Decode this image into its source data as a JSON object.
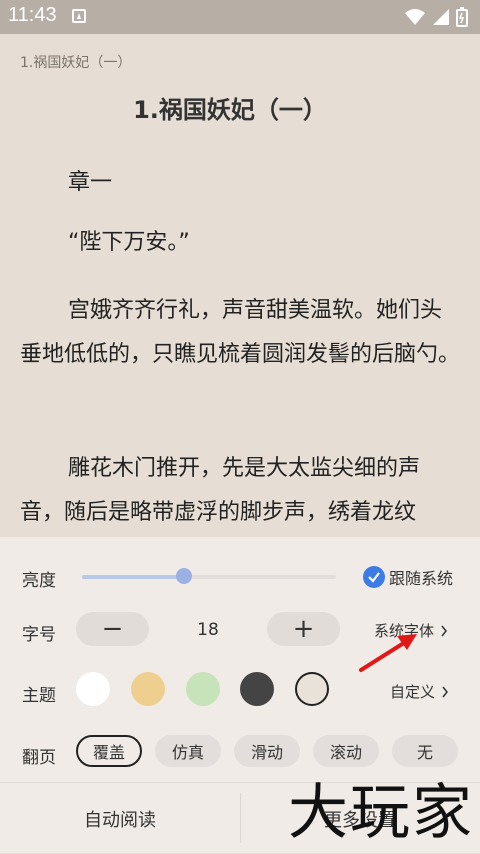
{
  "status_bar": {
    "time": "11:43"
  },
  "reader": {
    "header": "1.祸国妖妃（一）",
    "title": "1.祸国妖妃（一）",
    "paragraphs": [
      "章一",
      "“陛下万安。”",
      "宫娥齐齐行礼，声音甜美温软。她们头垂地低低的，只瞧见梳着圆润发髻的后脑勺。",
      "雕花木门推开，先是大太监尖细的声音，随后是略带虚浮的脚步声，绣着龙纹"
    ]
  },
  "settings": {
    "brightness": {
      "label": "亮度",
      "value": 0.4,
      "follow_label": "跟随系统",
      "follow_checked": true
    },
    "font_size": {
      "label": "字号",
      "minus": "−",
      "plus": "+",
      "value": "18",
      "font_link": "系统字体"
    },
    "theme": {
      "label": "主题",
      "custom_link": "自定义",
      "colors": [
        "#ffffff",
        "#efcf8f",
        "#c6e3b9",
        "#444444",
        "#e9e2d9"
      ]
    },
    "page_turn": {
      "label": "翻页",
      "options": [
        "覆盖",
        "仿真",
        "滑动",
        "滚动",
        "无"
      ],
      "selected": "覆盖"
    }
  },
  "bottom": {
    "auto_read": "自动阅读",
    "more_settings": "更多设置"
  },
  "watermark": "大玩家"
}
